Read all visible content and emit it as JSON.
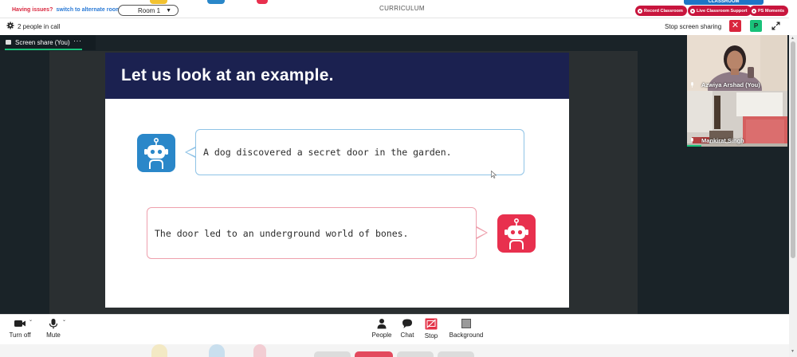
{
  "topbar": {
    "issues_text": "Having issues?",
    "alternate_link": "switch to alternate room",
    "room_value": "Room 1",
    "page_title": "CURRICULUM",
    "classroom_tab": "CLASSROOM",
    "buttons": {
      "record": "Record Classroom",
      "support": "Live Classroom Support",
      "moments": "PS Moments"
    }
  },
  "call": {
    "people_count": "2 people in call",
    "stop_sharing": "Stop screen sharing",
    "close_symbol": "✕",
    "user_initial": "P"
  },
  "share": {
    "tab_label": "Screen share (You)",
    "more_symbol": "···"
  },
  "slide": {
    "title": "Let us look at an example.",
    "bubble_1": "A dog discovered a secret door in the garden.",
    "bubble_2": "The door led to an underground world of bones."
  },
  "participants": [
    {
      "name": "Azwiya Arshad (You)"
    },
    {
      "name": "Mankirat Singh"
    }
  ],
  "controls": {
    "turn_off": "Turn off",
    "mute": "Mute",
    "people": "People",
    "chat": "Chat",
    "stop": "Stop",
    "background": "Background"
  },
  "colors": {
    "brand_red": "#c8153d",
    "accent_green": "#19c27a",
    "slide_navy": "#1b2150",
    "bot_blue": "#2a87c9",
    "bot_pink": "#e8304e"
  }
}
